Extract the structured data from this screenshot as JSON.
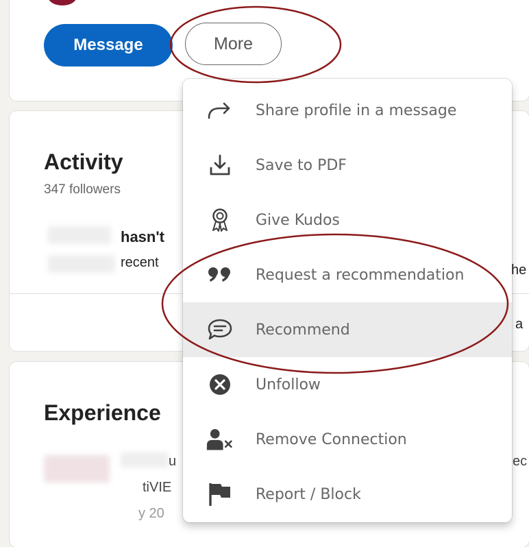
{
  "profile_actions": {
    "message_label": "Message",
    "more_label": "More"
  },
  "activity": {
    "title": "Activity",
    "followers": "347 followers",
    "line1": "hasn't",
    "line2": "recent",
    "frag_he": "he",
    "frag_a": "a"
  },
  "experience": {
    "title": "Experience",
    "frag_u": "u",
    "frag_tivie": "tiVIE",
    "frag_date": "y 20",
    "frag_ec": "ec"
  },
  "more_menu": {
    "items": [
      {
        "label": "Share profile in a message",
        "icon": "share-arrow-icon"
      },
      {
        "label": "Save to PDF",
        "icon": "download-icon"
      },
      {
        "label": "Give Kudos",
        "icon": "award-ribbon-icon"
      },
      {
        "label": "Request a recommendation",
        "icon": "quote-icon"
      },
      {
        "label": "Recommend",
        "icon": "speech-bubble-icon"
      },
      {
        "label": "Unfollow",
        "icon": "close-circle-icon"
      },
      {
        "label": "Remove Connection",
        "icon": "remove-person-icon"
      },
      {
        "label": "Report / Block",
        "icon": "flag-icon"
      }
    ]
  },
  "colors": {
    "primary_blue": "#0a66c2",
    "annotation_red": "#8b1a1a",
    "page_bg": "#f3f2ef",
    "hover_bg": "#ebebeb"
  }
}
